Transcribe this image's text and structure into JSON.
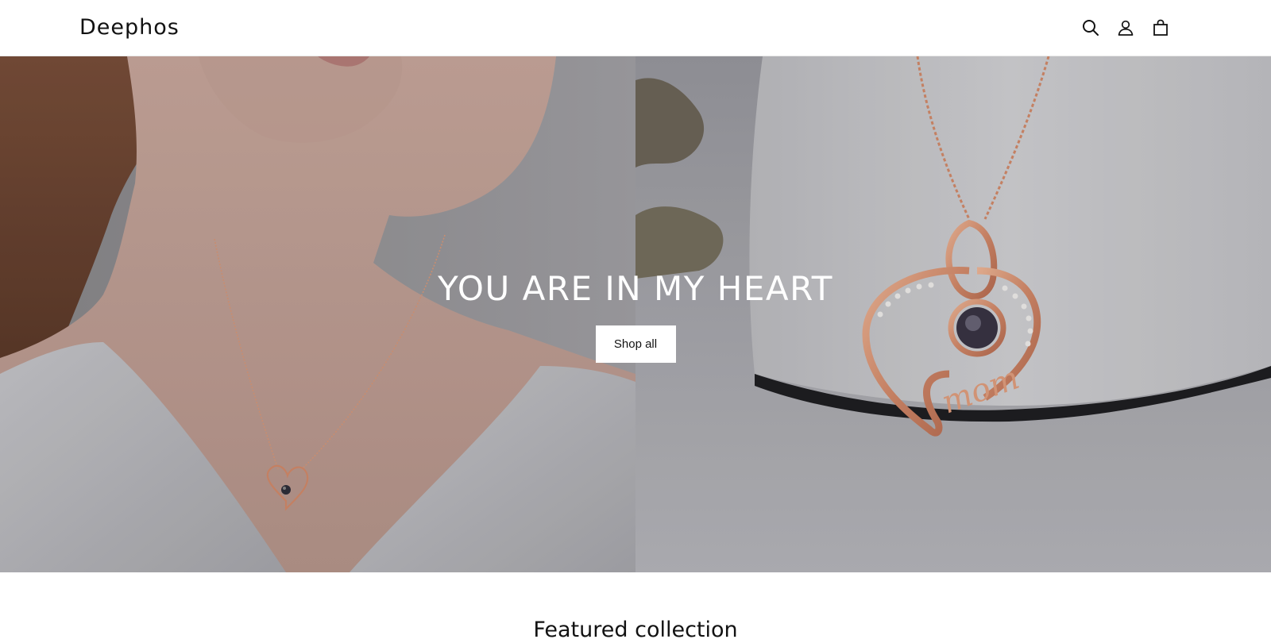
{
  "header": {
    "logo": "Deephos",
    "icons": [
      "search-icon",
      "account-icon",
      "cart-icon"
    ]
  },
  "hero": {
    "title": "YOU ARE IN MY HEART",
    "button_label": "Shop all",
    "right_pendant_text": "mom"
  },
  "featured": {
    "heading": "Featured collection"
  },
  "colors": {
    "background": "#ffffff",
    "text": "#121212",
    "rose_gold": "#d58b6b",
    "hero_title": "#ffffff"
  }
}
